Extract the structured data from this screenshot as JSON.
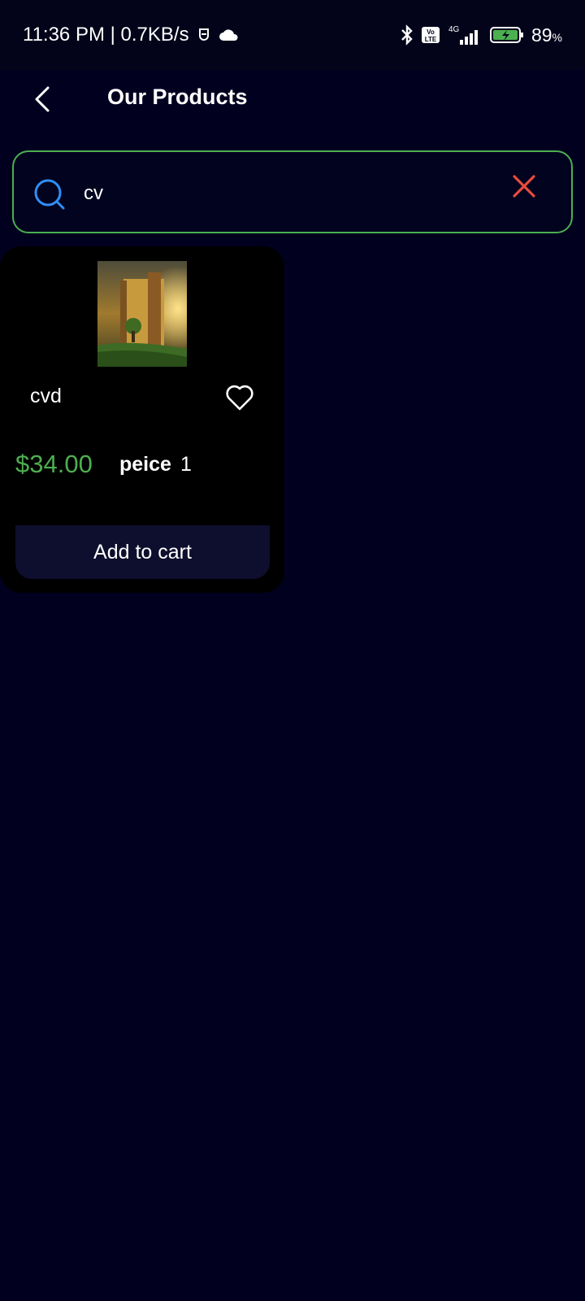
{
  "status_bar": {
    "time_speed": "11:36 PM | 0.7KB/s",
    "network": "4G",
    "volte": "Vo LTE",
    "battery": "89",
    "battery_unit": "%"
  },
  "header": {
    "title": "Our Products",
    "back_icon": "chevron-left-icon"
  },
  "search": {
    "value": "cv",
    "search_icon": "search-icon",
    "clear_icon": "close-icon"
  },
  "products": [
    {
      "name": "cvd",
      "price": "$34.00",
      "unit_label": "peice",
      "quantity": "1",
      "add_to_cart": "Add to cart",
      "favorite_icon": "heart-outline-icon"
    }
  ],
  "colors": {
    "background": "#01001f",
    "accent_green": "#4caf50",
    "clear_red": "#e74c3c",
    "search_blue": "#2f8ff7"
  }
}
